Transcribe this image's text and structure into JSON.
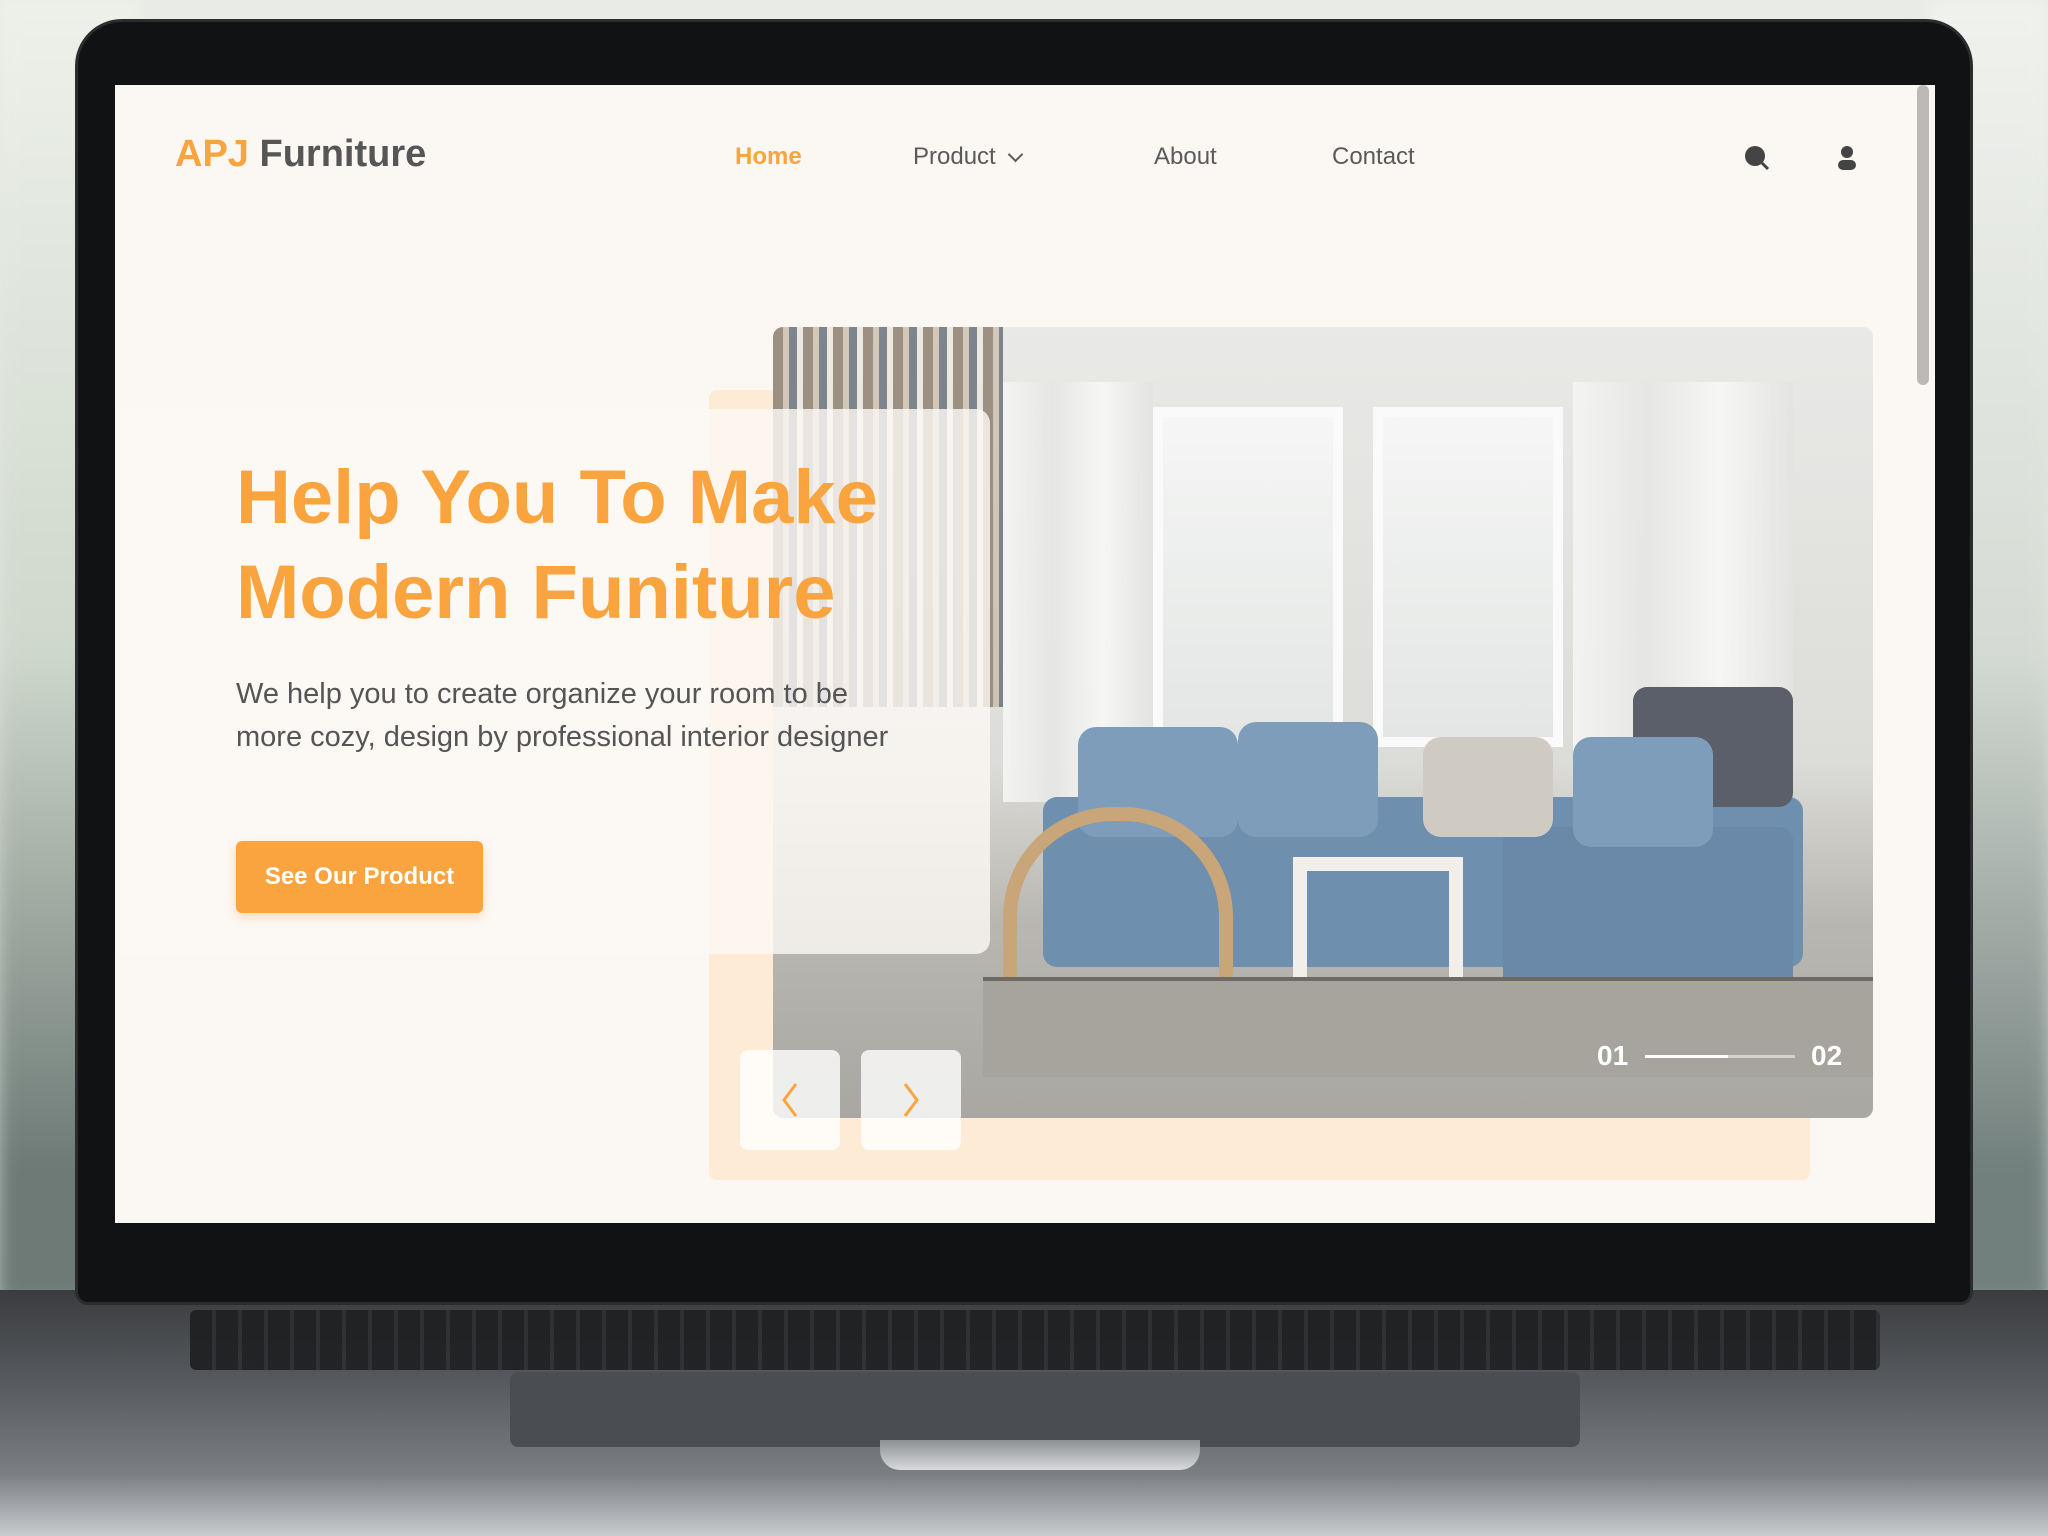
{
  "brand": {
    "accent": "APJ",
    "rest": "Furniture",
    "accent_color": "#f9a43f"
  },
  "nav": {
    "items": [
      "Home",
      "Product",
      "About",
      "Contact"
    ],
    "active": "Home"
  },
  "icons": {
    "search": "search-icon",
    "user": "user-icon",
    "prev": "chevron-left-icon",
    "next": "chevron-right-icon"
  },
  "hero": {
    "title_line1": "Help You To Make",
    "title_line2": "Modern Funiture",
    "description": "We help you to create organize your room to be more cozy, design by professional interior designer",
    "cta": "See Our Product"
  },
  "slider": {
    "current": "01",
    "total": "02",
    "progress": 0.55
  }
}
